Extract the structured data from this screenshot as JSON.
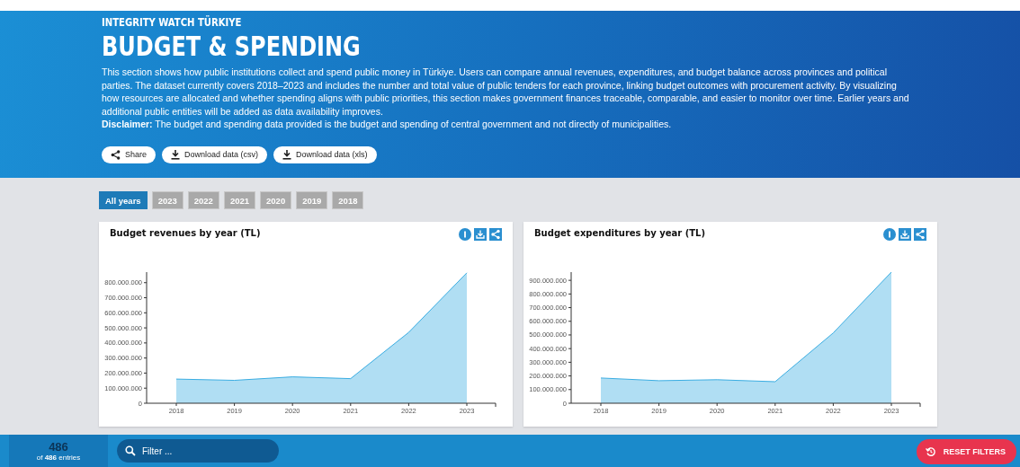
{
  "header": {
    "kicker": "INTEGRITY WATCH TÜRKIYE",
    "title": "BUDGET & SPENDING",
    "description": "This section shows how public institutions collect and spend public money in Türkiye. Users can compare annual revenues, expenditures, and budget balance across provinces and political parties. The dataset currently covers 2018–2023 and includes the number and total value of public tenders for each province, linking budget outcomes with procurement activity. By visualizing how resources are allocated and whether spending aligns with public priorities, this section makes government finances traceable, comparable, and easier to monitor over time. Earlier years and additional public entities will be added as data availability improves.",
    "disclaimer": "**Disclaimer:** The budget and spending data provided is the budget and spending of central government and not directly of municipalities.",
    "buttons": [
      {
        "kind": "share",
        "label": "Share"
      },
      {
        "kind": "download",
        "label": "Download data (csv)"
      },
      {
        "kind": "download",
        "label": "Download data (xls)"
      }
    ]
  },
  "year_tabs": [
    {
      "label": "All years",
      "selected": true
    },
    {
      "label": "2023",
      "selected": false
    },
    {
      "label": "2022",
      "selected": false
    },
    {
      "label": "2021",
      "selected": false
    },
    {
      "label": "2020",
      "selected": false
    },
    {
      "label": "2019",
      "selected": false
    },
    {
      "label": "2018",
      "selected": false
    }
  ],
  "charts": [
    {
      "title": "Budget revenues by year (TL)",
      "chart_data": {
        "type": "area",
        "categories": [
          "2018",
          "2019",
          "2020",
          "2021",
          "2022",
          "2023"
        ],
        "series": [
          {
            "color": "#3aade2",
            "values": [
              160000000,
              152000000,
              175000000,
              163000000,
              470000000,
              865000000
            ]
          }
        ],
        "ylim": [
          0,
          870000000
        ],
        "yticks": [
          {
            "value": 0,
            "label": "0"
          },
          {
            "value": 100000000,
            "label": "100.000.000"
          },
          {
            "value": 200000000,
            "label": "200.000.000"
          },
          {
            "value": 300000000,
            "label": "300.000.000"
          },
          {
            "value": 400000000,
            "label": "400.000.000"
          },
          {
            "value": 500000000,
            "label": "500.000.000"
          },
          {
            "value": 600000000,
            "label": "600.000.000"
          },
          {
            "value": 700000000,
            "label": "700.000.000"
          },
          {
            "value": 800000000,
            "label": "800.000.000"
          }
        ]
      }
    },
    {
      "title": "Budget expenditures by year (TL)",
      "chart_data": {
        "type": "area",
        "categories": [
          "2018",
          "2019",
          "2020",
          "2021",
          "2022",
          "2023"
        ],
        "series": [
          {
            "color": "#3aade2",
            "values": [
              185000000,
              165000000,
              172000000,
              158000000,
              515000000,
              960000000
            ]
          }
        ],
        "ylim": [
          0,
          960000000
        ],
        "yticks": [
          {
            "value": 0,
            "label": "0"
          },
          {
            "value": 100000000,
            "label": "100.000.000"
          },
          {
            "value": 200000000,
            "label": "200.000.000"
          },
          {
            "value": 300000000,
            "label": "300.000.000"
          },
          {
            "value": 400000000,
            "label": "400.000.000"
          },
          {
            "value": 500000000,
            "label": "500.000.000"
          },
          {
            "value": 600000000,
            "label": "600.000.000"
          },
          {
            "value": 700000000,
            "label": "700.000.000"
          },
          {
            "value": 800000000,
            "label": "800.000.000"
          },
          {
            "value": 900000000,
            "label": "900.000.000"
          }
        ]
      }
    }
  ],
  "footer": {
    "count": "486",
    "entries": "of **486** entries",
    "filter": {
      "placeholder": "Filter ..."
    },
    "reset_button": "RESET FILTERS"
  }
}
